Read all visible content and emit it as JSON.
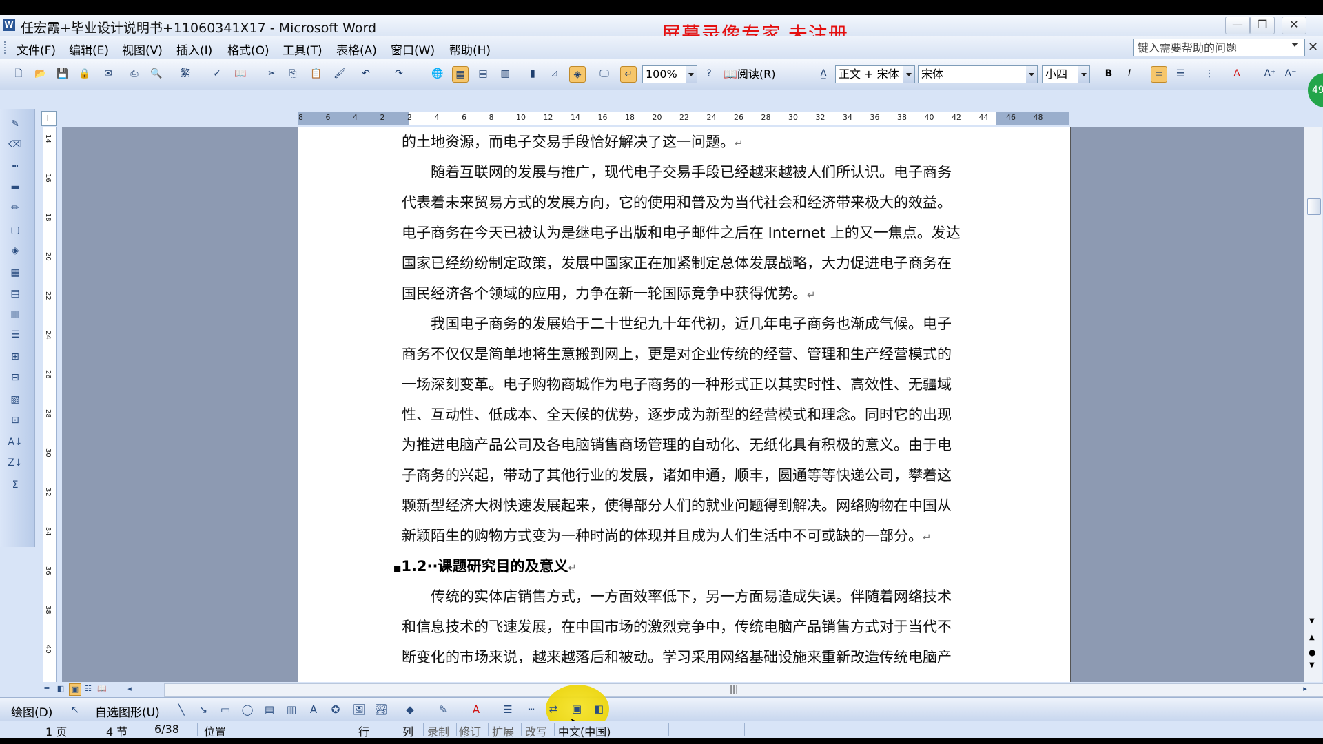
{
  "window": {
    "title": "任宏霞+毕业设计说明书+11060341X17 - Microsoft Word",
    "watermark": "屏幕录像专家  未注册"
  },
  "menu": [
    "文件(F)",
    "编辑(E)",
    "视图(V)",
    "插入(I)",
    "格式(O)",
    "工具(T)",
    "表格(A)",
    "窗口(W)",
    "帮助(H)"
  ],
  "help": {
    "placeholder": "键入需要帮助的问题"
  },
  "toolbar": {
    "zoom": "100%",
    "read_label": "阅读(R)",
    "style": "正文 + 宋体",
    "font": "宋体",
    "size": "小四",
    "bold_label": "B",
    "italic_label": "I"
  },
  "ruler": {
    "h_labels": [
      "8",
      "6",
      "4",
      "2",
      "2",
      "4",
      "6",
      "8",
      "10",
      "12",
      "14",
      "16",
      "18",
      "20",
      "22",
      "24",
      "26",
      "28",
      "30",
      "32",
      "34",
      "36",
      "38",
      "40",
      "42",
      "44",
      "46",
      "48"
    ],
    "v_labels": [
      "14",
      "16",
      "18",
      "20",
      "22",
      "24",
      "26",
      "28",
      "30",
      "32",
      "34",
      "36",
      "38",
      "40"
    ]
  },
  "document": {
    "p0": [
      "的土地资源，而电子交易手段恰好解决了这一问题。"
    ],
    "p1": [
      "　　随着互联网的发展与推广，现代电子交易手段已经越来越被人们所认识。电子商务",
      "代表着未来贸易方式的发展方向，它的使用和普及为当代社会和经济带来极大的效益。",
      "电子商务在今天已被认为是继电子出版和电子邮件之后在 Internet 上的又一焦点。发达",
      "国家已经纷纷制定政策，发展中国家正在加紧制定总体发展战略，大力促进电子商务在",
      "国民经济各个领域的应用，力争在新一轮国际竞争中获得优势。"
    ],
    "p2": [
      "　　我国电子商务的发展始于二十世纪九十年代初，近几年电子商务也渐成气候。电子",
      "商务不仅仅是简单地将生意搬到网上，更是对企业传统的经营、管理和生产经营模式的",
      "一场深刻变革。电子购物商城作为电子商务的一种形式正以其实时性、高效性、无疆域",
      "性、互动性、低成本、全天候的优势，逐步成为新型的经营模式和理念。同时它的出现",
      "为推进电脑产品公司及各电脑销售商场管理的自动化、无纸化具有积极的意义。由于电",
      "子商务的兴起，带动了其他行业的发展，诸如申通，顺丰，圆通等等快递公司，攀着这",
      "颗新型经济大树快速发展起来，使得部分人们的就业问题得到解决。网络购物在中国从",
      "新颖陌生的购物方式变为一种时尚的体现并且成为人们生活中不可或缺的一部分。"
    ],
    "heading": "1.2··课题研究目的及意义",
    "p3": [
      "　　传统的实体店销售方式，一方面效率低下，另一方面易造成失误。伴随着网络技术",
      "和信息技术的飞速发展，在中国市场的激烈竞争中，传统电脑产品销售方式对于当代不",
      "断变化的市场来说，越来越落后和被动。学习采用网络基础设施来重新改造传统电脑产"
    ]
  },
  "drawing_toolbar": {
    "draw_label": "绘图(D)",
    "autoshape_label": "自选图形(U)"
  },
  "status": {
    "page": "1 页",
    "section": "4 节",
    "page_of": "6/38",
    "position": "位置",
    "line": "行",
    "col": "列",
    "rec": "录制",
    "trk": "修订",
    "ext": "扩展",
    "ovr": "改写",
    "lang": "中文(中国)"
  },
  "badge": {
    "text": "49"
  }
}
